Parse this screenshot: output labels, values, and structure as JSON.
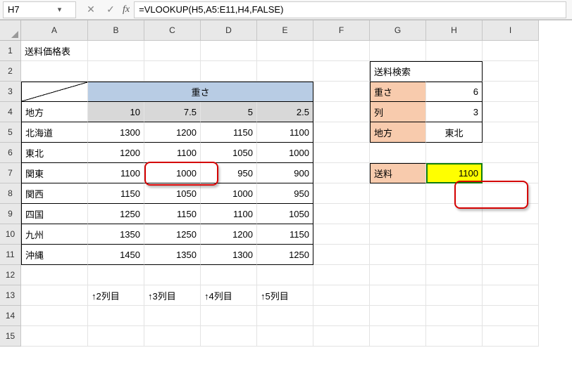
{
  "formula_bar": {
    "name_box": "H7",
    "formula": "=VLOOKUP(H5,A5:E11,H4,FALSE)"
  },
  "col_headers": [
    "A",
    "B",
    "C",
    "D",
    "E",
    "F",
    "G",
    "H",
    "I"
  ],
  "row_headers": [
    "1",
    "2",
    "3",
    "4",
    "5",
    "6",
    "7",
    "8",
    "9",
    "10",
    "11",
    "12",
    "13",
    "14",
    "15"
  ],
  "a1": "送料価格表",
  "weight_header": "重さ",
  "region_header": "地方",
  "weights": {
    "b": "10",
    "c": "7.5",
    "d": "5",
    "e": "2.5"
  },
  "table": {
    "rows": [
      {
        "name": "北海道",
        "b": "1300",
        "c": "1200",
        "d": "1150",
        "e": "1100"
      },
      {
        "name": "東北",
        "b": "1200",
        "c": "1100",
        "d": "1050",
        "e": "1000"
      },
      {
        "name": "関東",
        "b": "1100",
        "c": "1000",
        "d": "950",
        "e": "900"
      },
      {
        "name": "関西",
        "b": "1150",
        "c": "1050",
        "d": "1000",
        "e": "950"
      },
      {
        "name": "四国",
        "b": "1250",
        "c": "1150",
        "d": "1100",
        "e": "1050"
      },
      {
        "name": "九州",
        "b": "1350",
        "c": "1250",
        "d": "1200",
        "e": "1150"
      },
      {
        "name": "沖縄",
        "b": "1450",
        "c": "1350",
        "d": "1300",
        "e": "1250"
      }
    ]
  },
  "col_notes": {
    "b": "↑2列目",
    "c": "↑3列目",
    "d": "↑4列目",
    "e": "↑5列目"
  },
  "lookup": {
    "title": "送料検索",
    "labels": {
      "weight": "重さ",
      "col": "列",
      "region": "地方",
      "result": "送料"
    },
    "values": {
      "weight": "6",
      "col": "3",
      "region": "東北",
      "result": "1100"
    }
  }
}
